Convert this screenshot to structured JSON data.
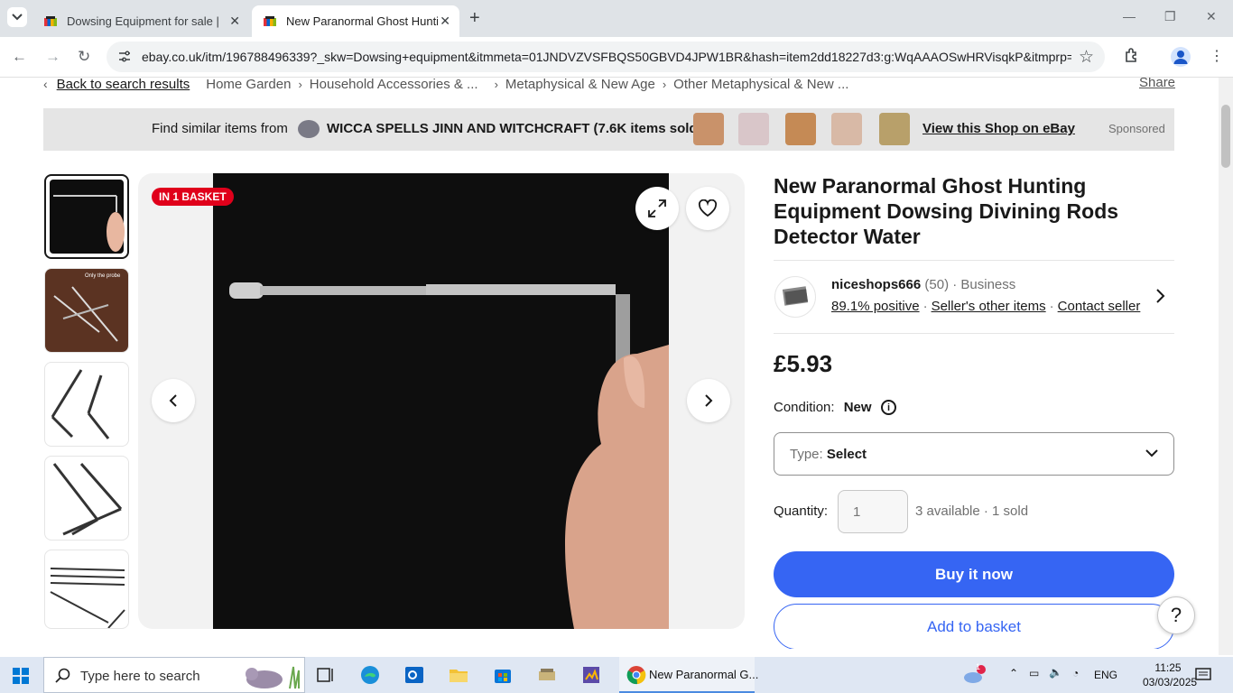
{
  "browser": {
    "tabs": [
      {
        "title": "Dowsing Equipment for sale | e",
        "active": false
      },
      {
        "title": "New Paranormal Ghost Hunting",
        "active": true
      }
    ],
    "url": "ebay.co.uk/itm/196788496339?_skw=Dowsing+equipment&itmmeta=01JNDVZVSFBQS50GBVD4JPW1BR&hash=item2dd18227d3:g:WqAAAOSwHRVisqkP&itmprp=..."
  },
  "breadcrumb": {
    "back": "Back to search results",
    "items": [
      "Home Garden",
      "Household Accessories & ...",
      "Metaphysical & New Age",
      "Other Metaphysical & New ..."
    ],
    "share": "Share"
  },
  "banner": {
    "lead": "Find similar items from",
    "shop": "WICCA SPELLS JINN AND WITCHCRAFT  (7.6K items sold)",
    "view": "View this Shop on eBay",
    "sponsored": "Sponsored"
  },
  "gallery": {
    "badge": "IN 1 BASKET",
    "thumb_caption": "Only the probe"
  },
  "item": {
    "title": "New Paranormal Ghost Hunting Equipment Dowsing Divining Rods Detector Water",
    "seller": {
      "name": "niceshops666",
      "count": "(50)",
      "type": "· Business",
      "positive": "89.1% positive",
      "other_items": "Seller's other items",
      "contact": "Contact seller"
    },
    "price": "£5.93",
    "condition_label": "Condition:",
    "condition_value": "New",
    "type_label": "Type:",
    "type_value": "Select",
    "quantity_label": "Quantity:",
    "quantity_value": "1",
    "availability": "3 available · 1 sold",
    "buy_now": "Buy it now",
    "add_to_basket": "Add to basket",
    "help": "?"
  },
  "taskbar": {
    "search_placeholder": "Type here to search",
    "chrome_label": "New Paranormal G...",
    "weather_badge": "1",
    "lang": "ENG",
    "time": "11:25",
    "date": "03/03/2025"
  },
  "colors": {
    "ebay_blue": "#3665f3",
    "badge_red": "#e0001b"
  }
}
